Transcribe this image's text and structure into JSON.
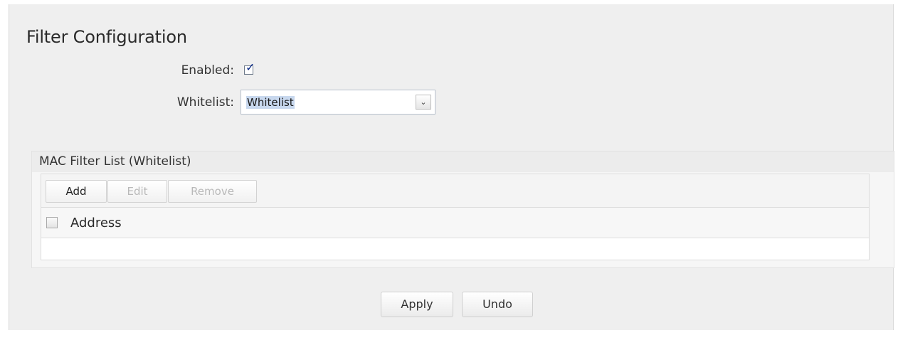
{
  "filter_config": {
    "title": "Filter Configuration",
    "enabled_label": "Enabled:",
    "enabled_checked": true,
    "whitelist_label": "Whitelist:",
    "whitelist_selected": "Whitelist"
  },
  "mac_filter": {
    "title": "MAC Filter List (Whitelist)",
    "toolbar": {
      "add_label": "Add",
      "edit_label": "Edit",
      "remove_label": "Remove"
    },
    "columns": [
      "Address"
    ],
    "rows": []
  },
  "actions": {
    "apply_label": "Apply",
    "undo_label": "Undo"
  },
  "icons": {
    "checkmark": "checkmark-icon",
    "dropdown": "chevron-down-icon"
  }
}
